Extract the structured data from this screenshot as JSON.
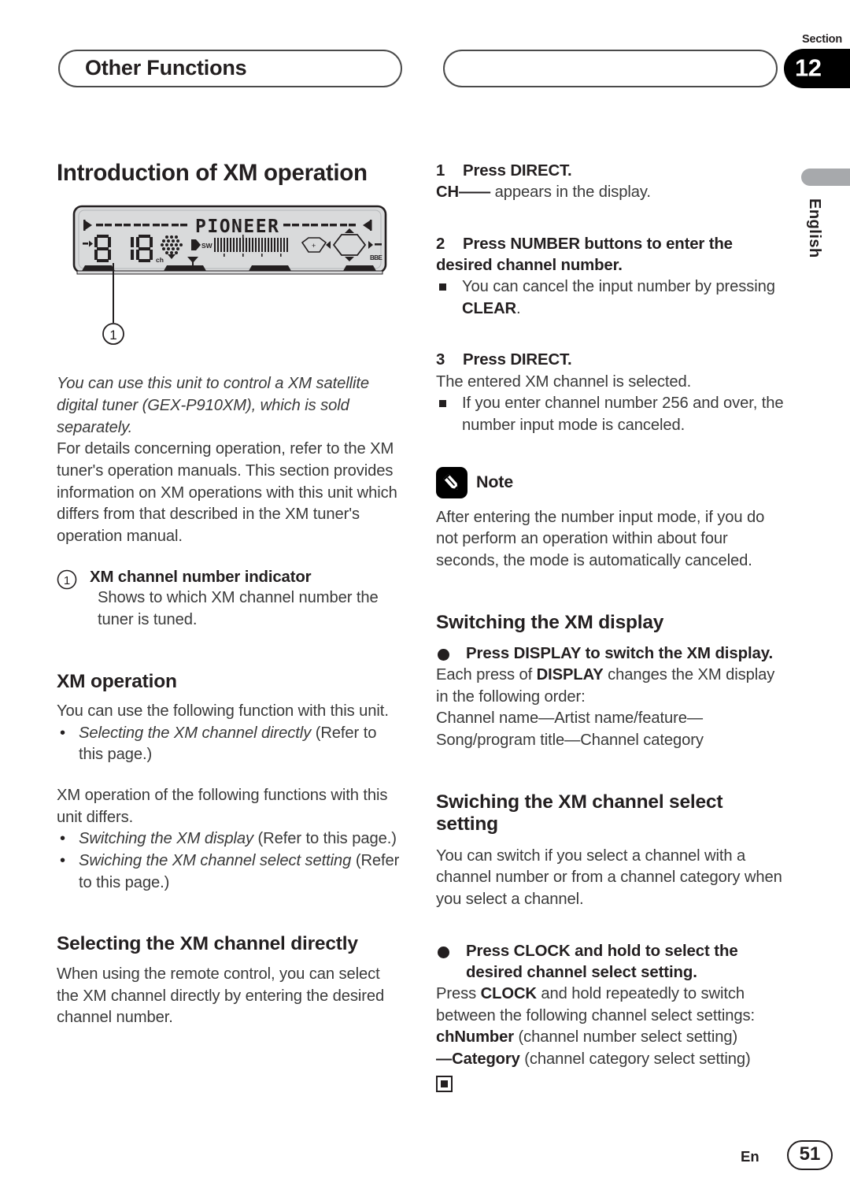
{
  "header": {
    "chapter_title": "Other Functions",
    "right_pill_title": "",
    "section_label": "Section",
    "section_number": "12"
  },
  "side_tab": {
    "language": "English"
  },
  "left_column": {
    "main_heading": "Introduction of XM operation",
    "device_figure": {
      "callout_number": "1",
      "brand_text": "PIONEER",
      "channel_number": "018",
      "channel_unit": "ch",
      "sw_label": "SW",
      "plus_label": "+",
      "bbe_label": "BBE"
    },
    "intro_italic": "You can use this unit to control a XM satellite digital tuner (GEX-P910XM), which is sold separately.",
    "intro_body": "For details concerning operation, refer to the XM tuner's operation manuals. This section provides information on XM operations with this unit which differs from that described in the XM tuner's operation manual.",
    "callout_item": {
      "marker": "1",
      "title": "XM channel number indicator",
      "body": "Shows to which XM channel number the tuner is tuned."
    },
    "xm_operation": {
      "heading": "XM operation",
      "body_1": "You can use the following function with this unit.",
      "bullet_1_italic": "Selecting the XM channel directly",
      "bullet_1_rest": " (Refer to this page.)",
      "body_2": "XM operation of the following functions with this unit differs.",
      "bullet_2_italic": "Switching the XM display",
      "bullet_2_rest": " (Refer to this page.)",
      "bullet_3_italic": "Swiching the XM channel select setting",
      "bullet_3_rest": " (Refer to this page.)"
    },
    "selecting_directly": {
      "heading": "Selecting the XM channel directly",
      "body": "When using the remote control, you can select the XM channel directly by entering the desired channel number."
    }
  },
  "right_column": {
    "step_1": {
      "number": "1",
      "title": "Press DIRECT.",
      "result_bold": "CH——",
      "result_rest": " appears in the display."
    },
    "step_2": {
      "number": "2",
      "title": "Press NUMBER buttons to enter the desired channel number.",
      "note_pre": "You can cancel the input number by pressing ",
      "note_bold": "CLEAR",
      "note_post": "."
    },
    "step_3": {
      "number": "3",
      "title": "Press DIRECT.",
      "result": "The entered XM channel is selected.",
      "note": "If you enter channel number 256 and over, the number input mode is canceled."
    },
    "note_block": {
      "label": "Note",
      "body": "After entering the number input mode, if you do not perform an operation within about four seconds, the mode is automatically canceled."
    },
    "switching_display": {
      "heading": "Switching the XM display",
      "action": "Press DISPLAY to switch the XM display.",
      "body_pre": "Each press of ",
      "body_bold": "DISPLAY",
      "body_post": " changes the XM display in the following order:",
      "order": "Channel name—Artist name/feature—Song/program title—Channel category"
    },
    "switching_channel_select": {
      "heading": "Swiching the XM channel select setting",
      "body": "You can switch if you select a channel with a channel number or from a channel category when you select a channel.",
      "action": "Press CLOCK and hold to select the desired channel select setting.",
      "detail_pre": "Press ",
      "detail_bold": "CLOCK",
      "detail_post": " and hold repeatedly to switch between the following channel select settings:",
      "option_1_bold": "chNumber",
      "option_1_rest": " (channel number select setting)",
      "option_2_bold": "—Category",
      "option_2_rest": " (channel category select setting)"
    }
  },
  "footer": {
    "language_code": "En",
    "page_number": "51"
  }
}
